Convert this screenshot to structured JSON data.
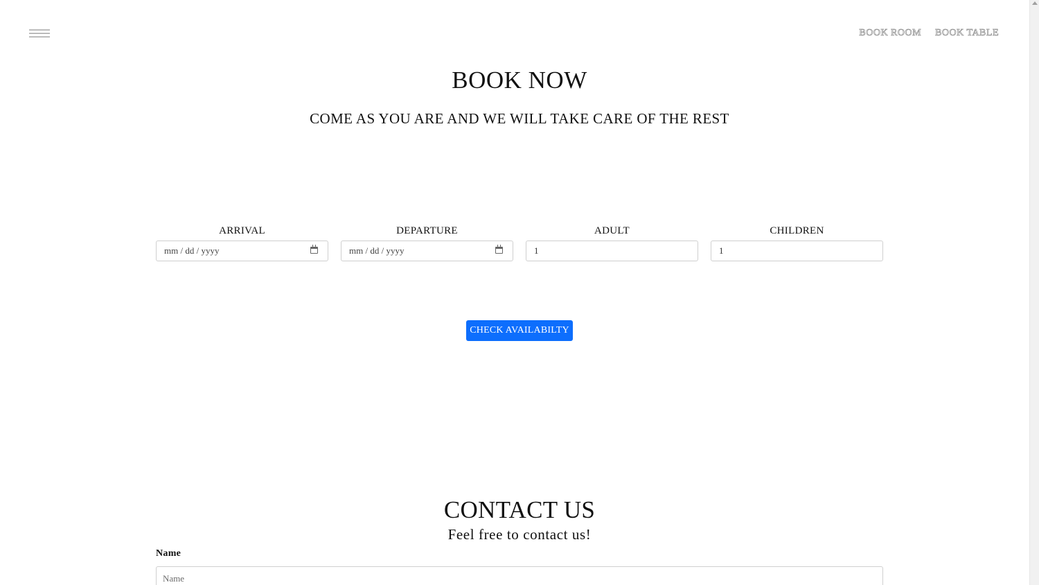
{
  "header": {
    "menu_icon": "hamburger-menu-icon",
    "nav": [
      {
        "label": "BOOK ROOM"
      },
      {
        "label": "BOOK TABLE"
      }
    ]
  },
  "booking": {
    "title": "BOOK NOW",
    "subtitle": "COME AS YOU ARE AND WE WILL TAKE CARE OF THE REST",
    "fields": {
      "arrival": {
        "label": "ARRIVAL",
        "value": "mm / dd / yyyy",
        "icon": "calendar-icon"
      },
      "departure": {
        "label": "DEPARTURE",
        "value": "mm / dd / yyyy",
        "icon": "calendar-icon"
      },
      "adult": {
        "label": "ADULT",
        "value": "1"
      },
      "children": {
        "label": "CHILDREN",
        "value": "1"
      }
    },
    "check_button": "CHECK AVAILABILTY",
    "accent_color": "#0d6efd"
  },
  "contact": {
    "title": "CONTACT US",
    "subtitle": "Feel free to contact us!",
    "name_label": "Name",
    "name_placeholder": "Name"
  }
}
